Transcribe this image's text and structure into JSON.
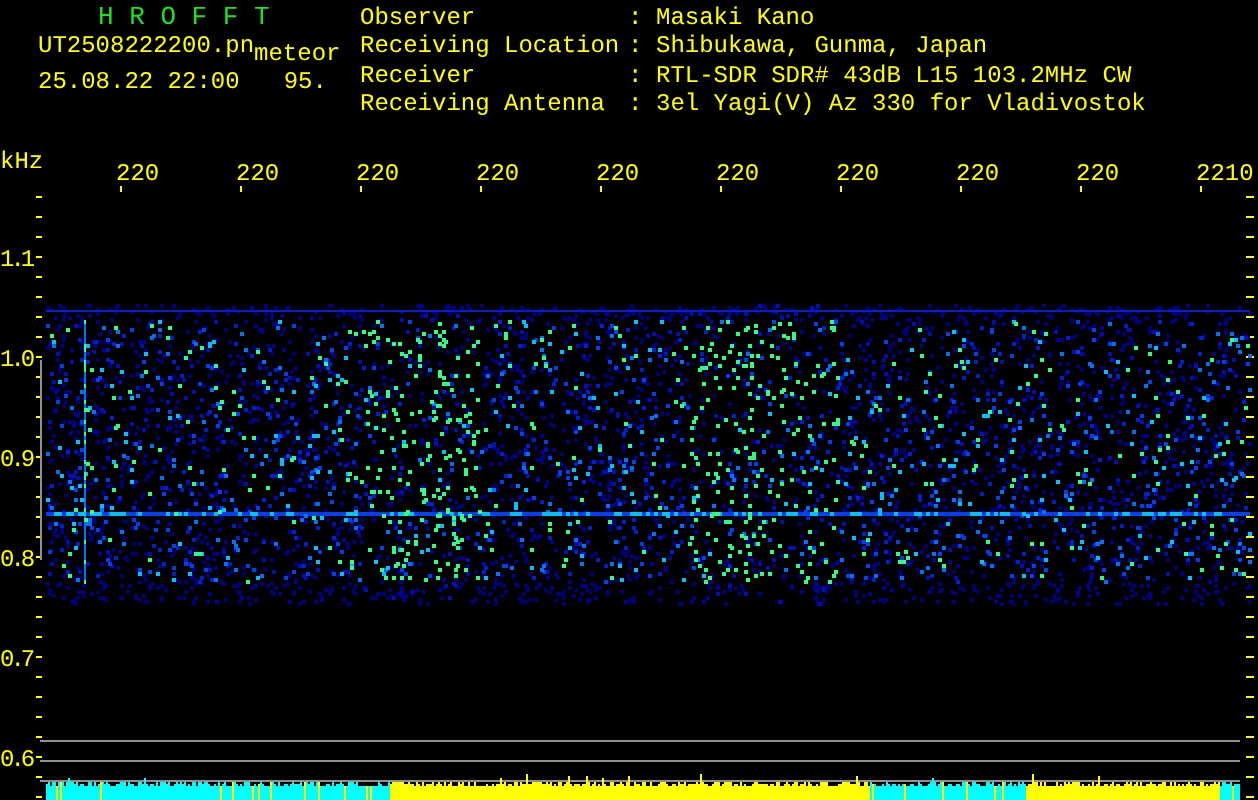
{
  "header": {
    "title": "H R O F F T",
    "file_name": "UT2508222200.pn",
    "mode": "meteor",
    "timestamp": "25.08.22 22:00",
    "value": "95."
  },
  "station_info": [
    {
      "label": "Observer",
      "separator": ":",
      "value": "Masaki Kano"
    },
    {
      "label": "Receiving Location",
      "separator": ":",
      "value": "Shibukawa, Gunma, Japan"
    },
    {
      "label": "Receiver",
      "separator": ":",
      "value": "RTL-SDR SDR# 43dB L15 103.2MHz CW"
    },
    {
      "label": "Receiving Antenna",
      "separator": ":",
      "value": "3el Yagi(V) Az 330 for Vladivostok"
    }
  ],
  "plot": {
    "unit": "kHz",
    "x_labels": [
      "220",
      "220",
      "220",
      "220",
      "220",
      "220",
      "220",
      "220",
      "220",
      "2210"
    ],
    "y_labels": [
      "1.1",
      "1.0",
      "0.9",
      "0.8",
      "0.7",
      "0.6"
    ]
  }
}
